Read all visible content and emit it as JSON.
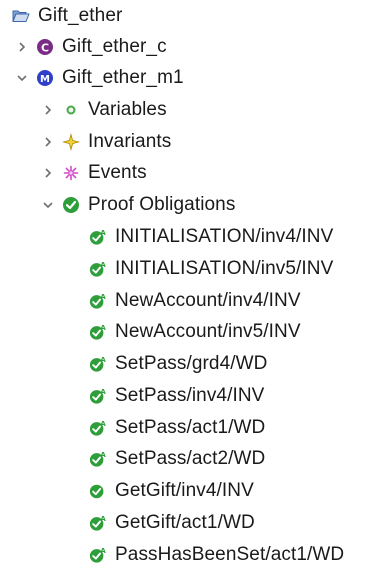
{
  "tree": {
    "root": {
      "label": "Gift_ether",
      "icon": "folder-open-icon",
      "expanded": true
    },
    "context": {
      "label": "Gift_ether_c",
      "icon": "context-icon",
      "expanded": false
    },
    "machine": {
      "label": "Gift_ether_m1",
      "icon": "machine-icon",
      "expanded": true
    },
    "variables": {
      "label": "Variables",
      "icon": "variables-icon",
      "expanded": false
    },
    "invariants": {
      "label": "Invariants",
      "icon": "invariants-icon",
      "expanded": false
    },
    "events": {
      "label": "Events",
      "icon": "events-icon",
      "expanded": false
    },
    "proof_obligations": {
      "label": "Proof Obligations",
      "icon": "discharged-check-icon",
      "expanded": true,
      "items": [
        {
          "label": "INITIALISATION/inv4/INV",
          "icon": "auto-discharged-icon"
        },
        {
          "label": "INITIALISATION/inv5/INV",
          "icon": "auto-discharged-icon"
        },
        {
          "label": "NewAccount/inv4/INV",
          "icon": "auto-discharged-icon"
        },
        {
          "label": "NewAccount/inv5/INV",
          "icon": "auto-discharged-icon"
        },
        {
          "label": "SetPass/grd4/WD",
          "icon": "auto-discharged-icon"
        },
        {
          "label": "SetPass/inv4/INV",
          "icon": "auto-discharged-icon"
        },
        {
          "label": "SetPass/act1/WD",
          "icon": "auto-discharged-icon"
        },
        {
          "label": "SetPass/act2/WD",
          "icon": "auto-discharged-icon"
        },
        {
          "label": "GetGift/inv4/INV",
          "icon": "discharged-check-icon"
        },
        {
          "label": "GetGift/act1/WD",
          "icon": "auto-discharged-icon"
        },
        {
          "label": "PassHasBeenSet/act1/WD",
          "icon": "auto-discharged-icon"
        }
      ]
    }
  },
  "colors": {
    "text": "#1a1a1a",
    "twisty": "#6f6f6f",
    "discharged_green": "#2e9e3a",
    "context_purple": "#7a2b86",
    "machine_blue": "#2f3fc9",
    "variables_green": "#4aa84a",
    "invariants_yellow": "#d7b000",
    "events_pink": "#d04bc4",
    "folder_blue": "#5a83c4"
  }
}
